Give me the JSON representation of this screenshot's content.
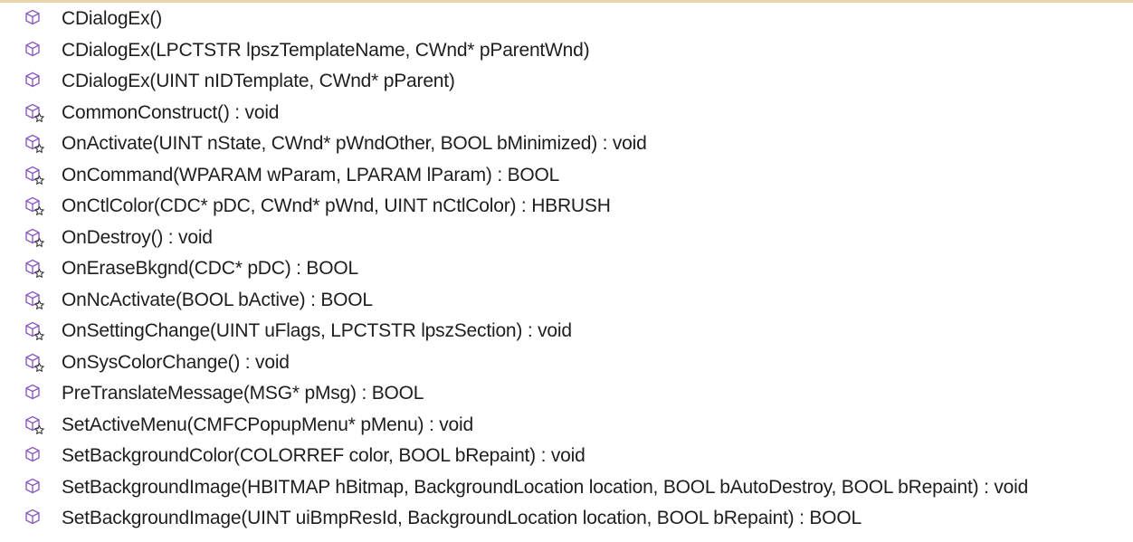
{
  "members": [
    {
      "label": "CDialogEx()",
      "icon": "public-method-icon"
    },
    {
      "label": "CDialogEx(LPCTSTR lpszTemplateName, CWnd* pParentWnd)",
      "icon": "public-method-icon"
    },
    {
      "label": "CDialogEx(UINT nIDTemplate, CWnd* pParent)",
      "icon": "public-method-icon"
    },
    {
      "label": "CommonConstruct() : void",
      "icon": "protected-method-icon"
    },
    {
      "label": "OnActivate(UINT nState, CWnd* pWndOther, BOOL bMinimized) : void",
      "icon": "protected-method-icon"
    },
    {
      "label": "OnCommand(WPARAM wParam, LPARAM lParam) : BOOL",
      "icon": "protected-method-icon"
    },
    {
      "label": "OnCtlColor(CDC* pDC, CWnd* pWnd, UINT nCtlColor) : HBRUSH",
      "icon": "protected-method-icon"
    },
    {
      "label": "OnDestroy() : void",
      "icon": "protected-method-icon"
    },
    {
      "label": "OnEraseBkgnd(CDC* pDC) : BOOL",
      "icon": "protected-method-icon"
    },
    {
      "label": "OnNcActivate(BOOL bActive) : BOOL",
      "icon": "protected-method-icon"
    },
    {
      "label": "OnSettingChange(UINT uFlags, LPCTSTR lpszSection) : void",
      "icon": "protected-method-icon"
    },
    {
      "label": "OnSysColorChange() : void",
      "icon": "protected-method-icon"
    },
    {
      "label": "PreTranslateMessage(MSG* pMsg) : BOOL",
      "icon": "public-method-icon"
    },
    {
      "label": "SetActiveMenu(CMFCPopupMenu* pMenu) : void",
      "icon": "protected-method-icon"
    },
    {
      "label": "SetBackgroundColor(COLORREF color, BOOL bRepaint) : void",
      "icon": "public-method-icon"
    },
    {
      "label": "SetBackgroundImage(HBITMAP hBitmap, BackgroundLocation location, BOOL bAutoDestroy, BOOL bRepaint) : void",
      "icon": "public-method-icon"
    },
    {
      "label": "SetBackgroundImage(UINT uiBmpResId, BackgroundLocation location, BOOL bRepaint) : BOOL",
      "icon": "public-method-icon"
    }
  ],
  "colors": {
    "icon_stroke": "#8a5cc0",
    "text": "#1e1e1e",
    "top_border": "#e9d5a8"
  }
}
